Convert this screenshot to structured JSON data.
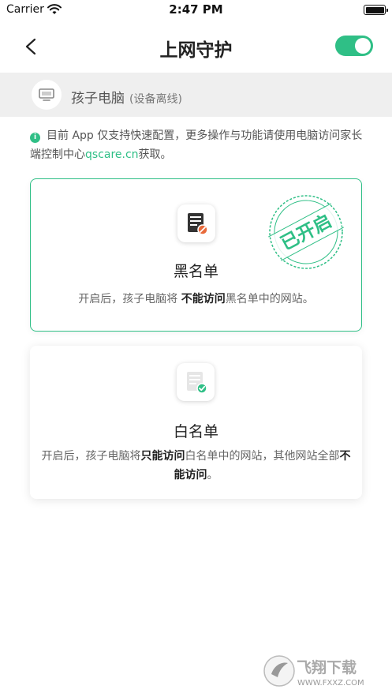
{
  "status_bar": {
    "carrier": "Carrier",
    "time": "2:47 PM"
  },
  "nav": {
    "title": "上网守护",
    "toggle_on": true
  },
  "device": {
    "name": "孩子电脑",
    "status": "(设备离线)"
  },
  "notice": {
    "text": "目前 App 仅支持快速配置，更多操作与功能请使用电脑访问家长端控制中心",
    "link": "qscare.cn",
    "suffix": "获取。"
  },
  "blacklist": {
    "title": "黑名单",
    "stamp": "已开启",
    "desc_prefix": "开启后，孩子电脑将 ",
    "desc_bold": "不能访问",
    "desc_suffix": "黑名单中的网站。"
  },
  "whitelist": {
    "title": "白名单",
    "desc_prefix": "开启后，孩子电脑将",
    "desc_bold1": "只能访问",
    "desc_mid": "白名单中的网站，其他网站全部",
    "desc_bold2": "不能访问",
    "desc_suffix": "。"
  },
  "watermark": {
    "text": "飞翔下载",
    "url": "WWW.FXXZ.COM"
  },
  "colors": {
    "accent": "#2fbf86",
    "danger": "#e86a3a"
  }
}
